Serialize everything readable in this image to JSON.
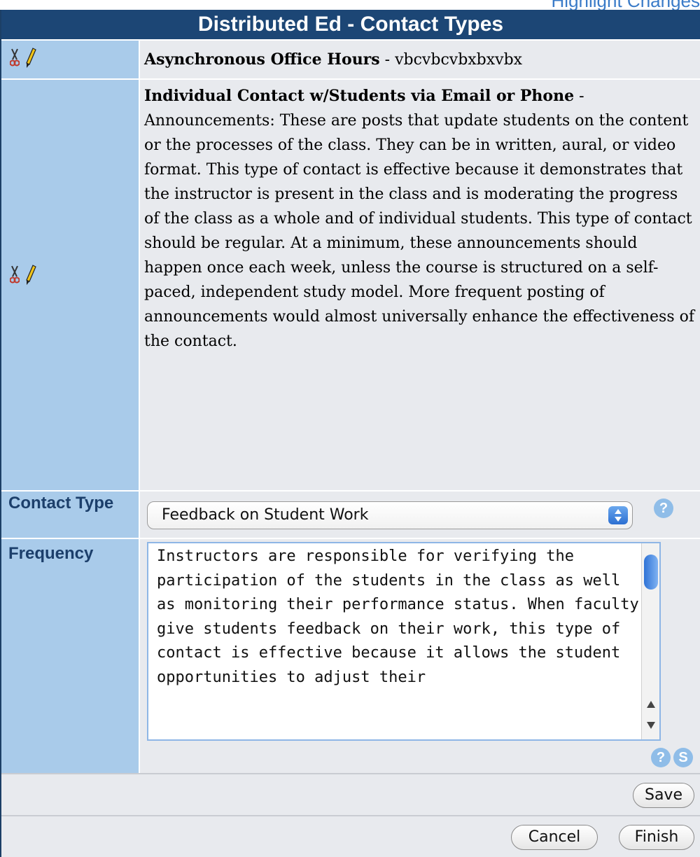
{
  "top_link": {
    "text": "Highlight Changes"
  },
  "title": "Distributed Ed - Contact Types",
  "entries": [
    {
      "title": "Asynchronous Office Hours",
      "separator": " - ",
      "description": "vbcvbcvbxbxvbx"
    },
    {
      "title": "Individual Contact w/Students via Email or Phone",
      "separator": " - ",
      "description": "Announcements: These are posts that update students on the content or the processes of the class. They can be in written, aural, or video format. This type of contact is effective because it demonstrates that the instructor is present in the class and is moderating the progress of the class as a whole and of individual students. This type of contact should be regular. At a minimum, these announcements should happen once each week, unless the course is structured on a self-paced, independent study model. More frequent posting of announcements would almost universally enhance the effectiveness of the contact."
    }
  ],
  "form": {
    "contact_type_label": "Contact Type",
    "contact_type_value": "Feedback on Student Work",
    "frequency_label": "Frequency",
    "frequency_value": "Instructors are responsible for verifying the participation of the students in the class as well as monitoring their performance status. When faculty give students feedback on their work, this type of contact is effective because it allows the student opportunities to adjust their"
  },
  "icons": {
    "help": "?",
    "spell": "S"
  },
  "buttons": {
    "save": "Save",
    "cancel": "Cancel",
    "finish": "Finish"
  },
  "colors": {
    "header_bg": "#1c4675",
    "label_bg": "#a9cbea",
    "content_bg": "#e8eaee",
    "link": "#3a7bc8"
  }
}
